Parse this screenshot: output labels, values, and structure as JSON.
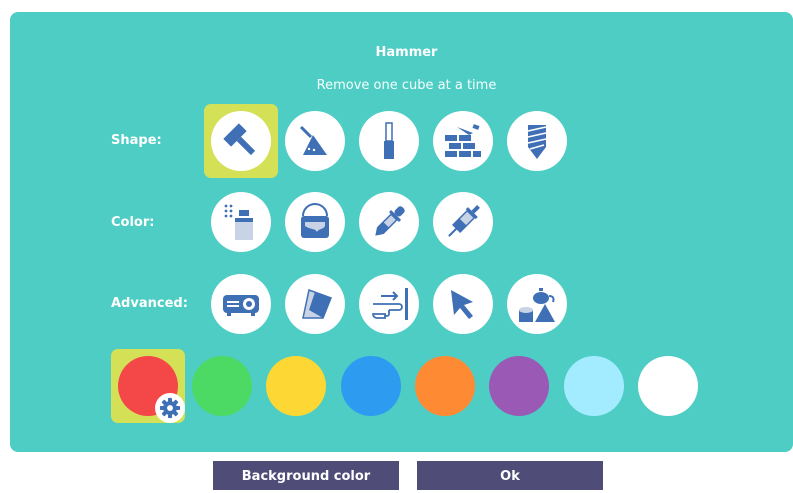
{
  "dialog": {
    "title": "Hammer",
    "description": "Remove one cube at a time"
  },
  "rows": {
    "shape_label": "Shape:",
    "color_label": "Color:",
    "advanced_label": "Advanced:"
  },
  "tools": {
    "shape": [
      "hammer-icon",
      "trowel-icon",
      "chisel-icon",
      "brick-wall-icon",
      "drill-bit-icon"
    ],
    "color": [
      "spray-can-icon",
      "paint-bucket-icon",
      "eyedropper-icon",
      "syringe-icon"
    ],
    "advanced": [
      "projector-icon",
      "paper-icon",
      "hand-pointer-icon",
      "arrow-cursor-icon",
      "shapes-icon"
    ],
    "selected": "hammer-icon"
  },
  "palette": {
    "colors": [
      "#f44747",
      "#4cd964",
      "#fdd835",
      "#2d9cf0",
      "#ff8a34",
      "#9b59b6",
      "#a3ecff",
      "#ffffff"
    ],
    "selected_index": 0
  },
  "buttons": {
    "background_color": "Background color",
    "ok": "Ok"
  },
  "colors": {
    "panel": "#4ecdc4",
    "highlight": "#d4e157",
    "icon_blue": "#3f6fb5",
    "button": "#4f4d78"
  }
}
